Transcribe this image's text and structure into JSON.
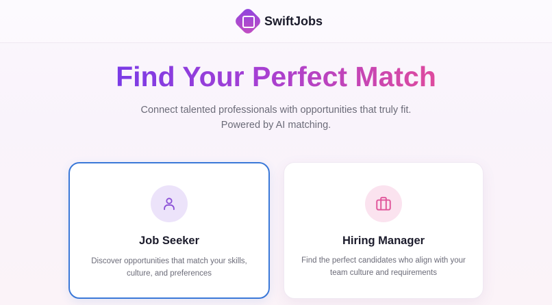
{
  "brand": {
    "name": "SwiftJobs",
    "logo_icon": "square-diamond-logo-icon"
  },
  "hero": {
    "title": "Find Your Perfect Match",
    "subtitle_line1": "Connect talented professionals with opportunities that truly fit.",
    "subtitle_line2": "Powered by AI matching."
  },
  "cards": [
    {
      "icon": "user-icon",
      "title": "Job Seeker",
      "description_line1": "Discover opportunities that match your skills,",
      "description_line2": "culture, and preferences",
      "selected": true
    },
    {
      "icon": "briefcase-icon",
      "title": "Hiring Manager",
      "description_line1": "Find the perfect candidates who align with your",
      "description_line2": "team culture and requirements",
      "selected": false
    }
  ],
  "colors": {
    "gradient_start": "#7a3be6",
    "gradient_end": "#de4a9e",
    "selected_border": "#3a78d8",
    "seeker_icon": "#8a4fd6",
    "manager_icon": "#e0559a"
  }
}
